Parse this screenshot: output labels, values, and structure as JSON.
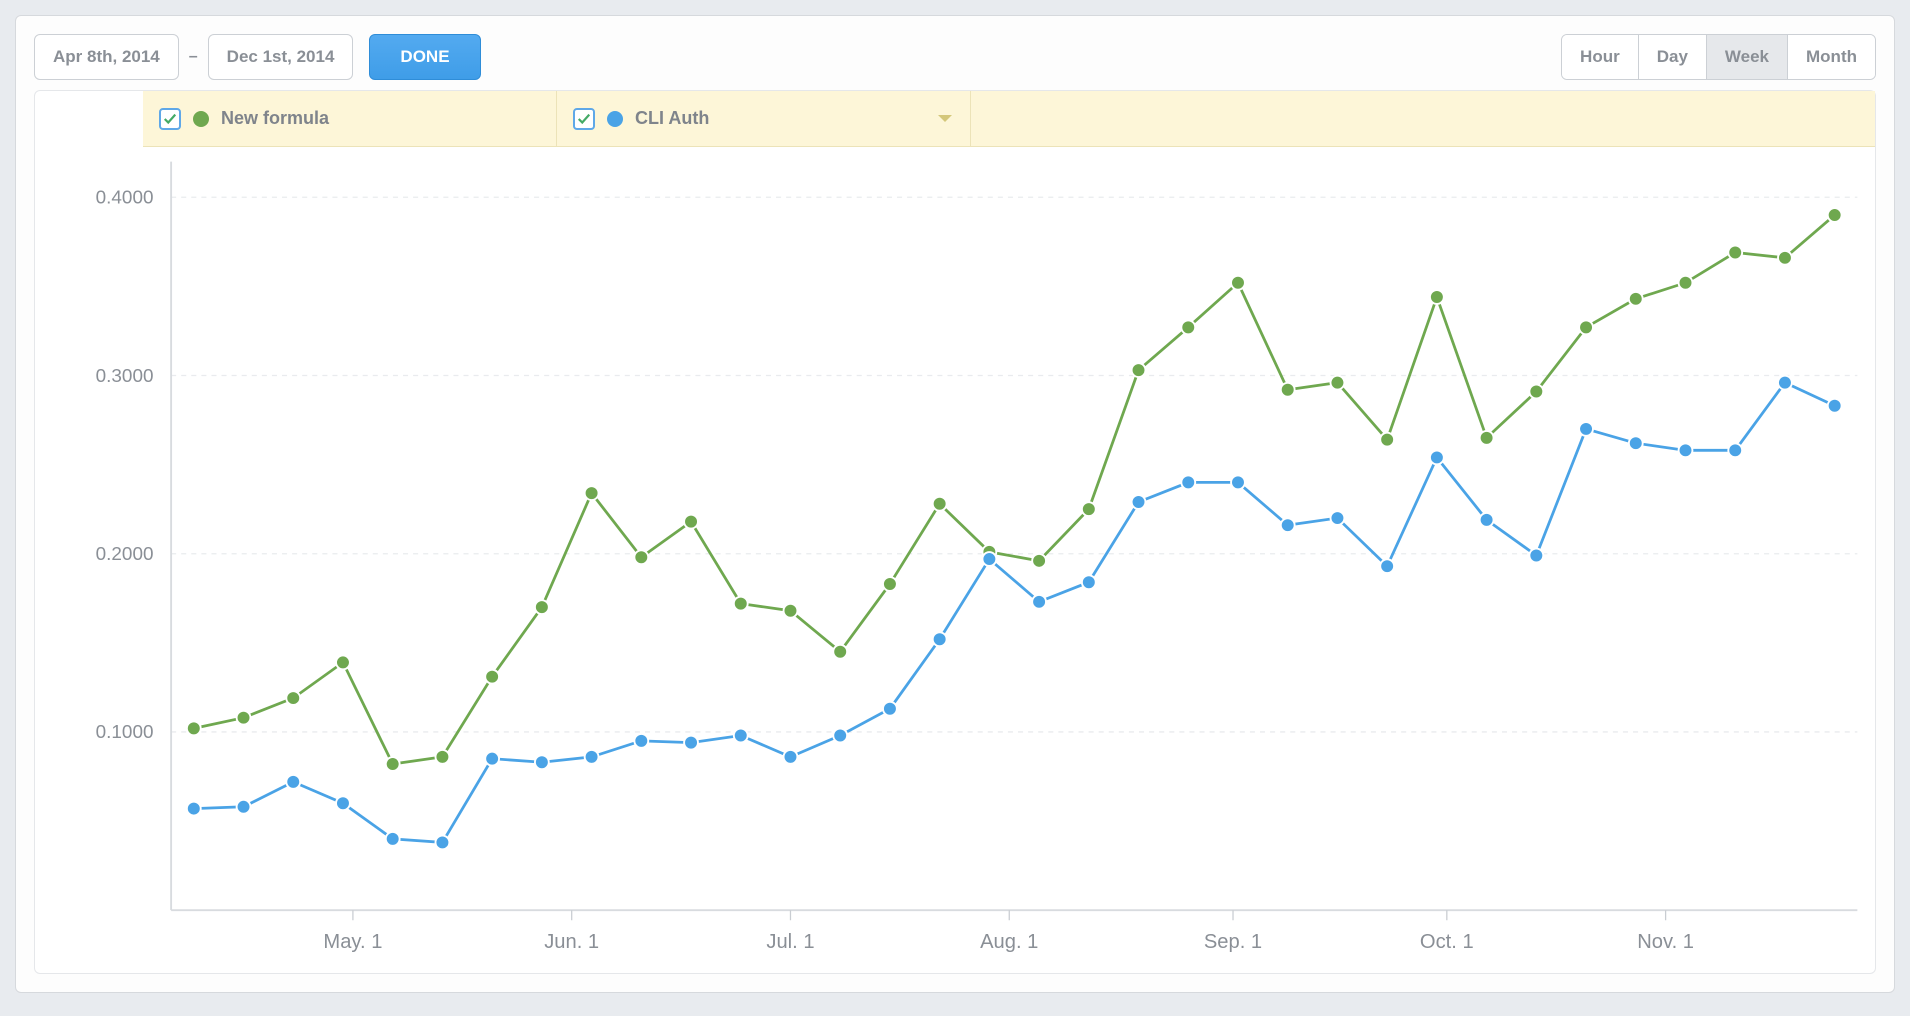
{
  "toolbar": {
    "date_from": "Apr 8th, 2014",
    "date_to": "Dec 1st, 2014",
    "date_dash": "–",
    "done_label": "DONE",
    "granularity": [
      {
        "label": "Hour",
        "active": false
      },
      {
        "label": "Day",
        "active": false
      },
      {
        "label": "Week",
        "active": true
      },
      {
        "label": "Month",
        "active": false
      }
    ]
  },
  "legend": [
    {
      "name": "New formula",
      "color": "#6fa84f",
      "checked": true
    },
    {
      "name": "CLI Auth",
      "color": "#4aa3e6",
      "checked": true,
      "has_caret": true
    }
  ],
  "chart_data": {
    "type": "line",
    "ylim": [
      0,
      0.42
    ],
    "y_ticks": [
      0.1,
      0.2,
      0.3,
      0.4
    ],
    "y_tick_labels": [
      "0.1000",
      "0.2000",
      "0.3000",
      "0.4000"
    ],
    "x_major_ticks": [
      {
        "index": 3.2,
        "label": "May. 1"
      },
      {
        "index": 7.6,
        "label": "Jun. 1"
      },
      {
        "index": 12.0,
        "label": "Jul. 1"
      },
      {
        "index": 16.4,
        "label": "Aug. 1"
      },
      {
        "index": 20.9,
        "label": "Sep. 1"
      },
      {
        "index": 25.2,
        "label": "Oct. 1"
      },
      {
        "index": 29.6,
        "label": "Nov. 1"
      }
    ],
    "series": [
      {
        "name": "New formula",
        "color": "#6fa84f",
        "values": [
          0.102,
          0.108,
          0.119,
          0.139,
          0.082,
          0.086,
          0.131,
          0.17,
          0.234,
          0.198,
          0.218,
          0.172,
          0.168,
          0.145,
          0.183,
          0.228,
          0.201,
          0.196,
          0.225,
          0.303,
          0.327,
          0.352,
          0.292,
          0.296,
          0.264,
          0.344,
          0.265,
          0.291,
          0.327,
          0.343,
          0.352,
          0.369,
          0.366,
          0.39
        ]
      },
      {
        "name": "CLI Auth",
        "color": "#4aa3e6",
        "values": [
          0.057,
          0.058,
          0.072,
          0.06,
          0.04,
          0.038,
          0.085,
          0.083,
          0.086,
          0.095,
          0.094,
          0.098,
          0.086,
          0.098,
          0.113,
          0.152,
          0.197,
          0.173,
          0.184,
          0.229,
          0.24,
          0.24,
          0.216,
          0.22,
          0.193,
          0.254,
          0.219,
          0.199,
          0.27,
          0.262,
          0.258,
          0.258,
          0.296,
          0.283
        ]
      }
    ]
  }
}
